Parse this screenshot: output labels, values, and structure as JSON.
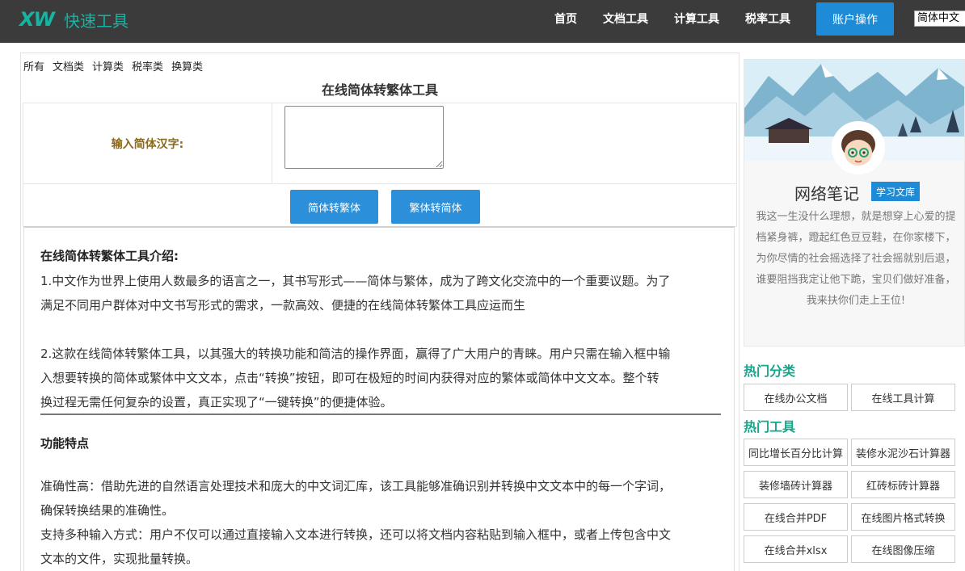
{
  "header": {
    "logo_mark": "XW",
    "logo_text": "快速工具",
    "nav": [
      "首页",
      "文档工具",
      "计算工具",
      "税率工具"
    ],
    "account_button": "账户操作",
    "language_select": "简体中文"
  },
  "main": {
    "categories": [
      "所有",
      "文档类",
      "计算类",
      "税率类",
      "换算类"
    ],
    "tool_title": "在线简体转繁体工具",
    "input_label": "输入简体汉字:",
    "input_value": "",
    "btn_to_traditional": "简体转繁体",
    "btn_to_simplified": "繁体转简体"
  },
  "article": {
    "heading": "在线简体转繁体工具介绍:",
    "p1_line1": "1.中文作为世界上使用人数最多的语言之一，其书写形式——简体与繁体，成为了跨文化交流中的一个重要议题。为了",
    "p1_line2": "满足不同用户群体对中文书写形式的需求，一款高效、便捷的在线简体转繁体工具应运而生",
    "p2_line1": "2.这款在线简体转繁体工具，以其强大的转换功能和简洁的操作界面，赢得了广大用户的青睐。用户只需在输入框中输",
    "p2_line2": "入想要转换的简体或繁体中文文本，点击“转换”按钮，即可在极短的时间内获得对应的繁体或简体中文文本。整个转",
    "p2_line3": "换过程无需任何复杂的设置，真正实现了“一键转换”的便捷体验。",
    "features_heading": "功能特点",
    "f1_line1": "准确性高：借助先进的自然语言处理技术和庞大的中文词汇库，该工具能够准确识别并转换中文文本中的每一个字词，",
    "f1_line2": "确保转换结果的准确性。",
    "f2_line1": "支持多种输入方式：用户不仅可以通过直接输入文本进行转换，还可以将文档内容粘贴到输入框中，或者上传包含中文",
    "f2_line2": "文本的文件，实现批量转换。"
  },
  "sidebar": {
    "profile_name": "网络笔记",
    "profile_badge": "学习文库",
    "bio": "我这一生没什么理想，就是想穿上心爱的提档紧身裤，蹬起红色豆豆鞋，在你家楼下，为你尽情的社会摇选择了社会摇就别后退，谁要阻挡我定让他下跪，宝贝们做好准备，我来扶你们走上王位!",
    "hot_categories_title": "热门分类",
    "hot_categories": [
      "在线办公文档",
      "在线工具计算"
    ],
    "hot_tools_title": "热门工具",
    "hot_tools": [
      "同比增长百分比计算",
      "装修水泥沙石计算器",
      "装修墙砖计算器",
      "红砖标砖计算器",
      "在线合并PDF",
      "在线图片格式转换",
      "在线合并xlsx",
      "在线图像压缩"
    ]
  },
  "colors": {
    "header_bg": "#3b3b3b",
    "brand_teal": "#17b3a3",
    "primary_blue": "#2b90d9",
    "section_green": "#17a589",
    "label_brown": "#8b6a1e"
  }
}
